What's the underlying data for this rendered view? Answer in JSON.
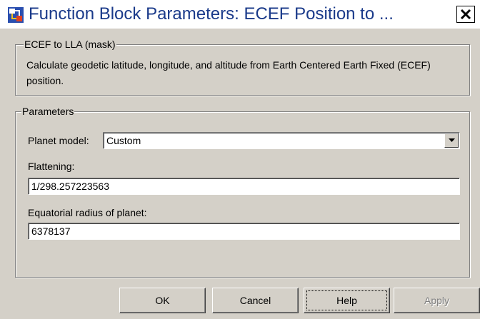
{
  "window": {
    "title": "Function Block Parameters: ECEF Position to ..."
  },
  "mask_group": {
    "caption": "ECEF to LLA (mask)",
    "description": "Calculate geodetic latitude, longitude, and altitude from Earth Centered Earth Fixed (ECEF) position."
  },
  "parameters_group": {
    "caption": "Parameters",
    "planet_model": {
      "label": "Planet model:",
      "value": "Custom"
    },
    "flattening": {
      "label": "Flattening:",
      "value": "1/298.257223563"
    },
    "equatorial_radius": {
      "label": "Equatorial radius of planet:",
      "value": "6378137"
    }
  },
  "buttons": {
    "ok": "OK",
    "cancel": "Cancel",
    "help": "Help",
    "apply": "Apply"
  },
  "icons": {
    "app": "simulink-block-icon",
    "close": "close-icon",
    "dropdown": "chevron-down-icon"
  },
  "colors": {
    "dialog_bg": "#d4d0c8",
    "title_text": "#1a3a8a",
    "disabled_text": "#808080"
  }
}
